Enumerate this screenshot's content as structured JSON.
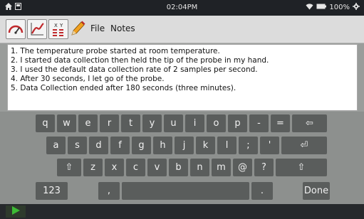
{
  "status": {
    "time": "02:04PM",
    "battery": "100%"
  },
  "toolbar": {
    "file_label": "File",
    "notes_label": "Notes"
  },
  "notes": {
    "lines": [
      "1. The temperature probe started at room temperature.",
      "2. I started data collection then held the tip of the probe in my hand.",
      "3. I used the default data collection rate of 2 samples per second.",
      "4. After 30 seconds, I let go of the probe.",
      "5. Data Collection ended after 180 seconds (three minutes)."
    ]
  },
  "keyboard": {
    "row1": [
      "q",
      "w",
      "e",
      "r",
      "t",
      "y",
      "u",
      "i",
      "o",
      "p",
      "-",
      "=",
      "⇦"
    ],
    "row2": [
      "a",
      "s",
      "d",
      "f",
      "g",
      "h",
      "j",
      "k",
      "l",
      ";",
      "'",
      "⏎"
    ],
    "row3": [
      "⇧",
      "z",
      "x",
      "c",
      "v",
      "b",
      "n",
      "m",
      "@",
      "?",
      "⇧"
    ],
    "row4": [
      "123",
      ",",
      "",
      ".",
      "Done"
    ]
  }
}
